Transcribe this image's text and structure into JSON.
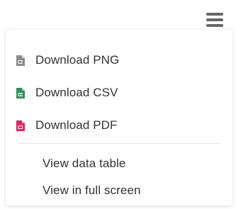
{
  "menu": {
    "items": [
      {
        "label": "Download PNG",
        "icon": "png-file-icon",
        "color": "#7a7a7a"
      },
      {
        "label": "Download CSV",
        "icon": "csv-file-icon",
        "color": "#2f8f57"
      },
      {
        "label": "Download PDF",
        "icon": "pdf-file-icon",
        "color": "#e0245e"
      },
      {
        "label": "View data table"
      },
      {
        "label": "View in full screen"
      }
    ]
  }
}
